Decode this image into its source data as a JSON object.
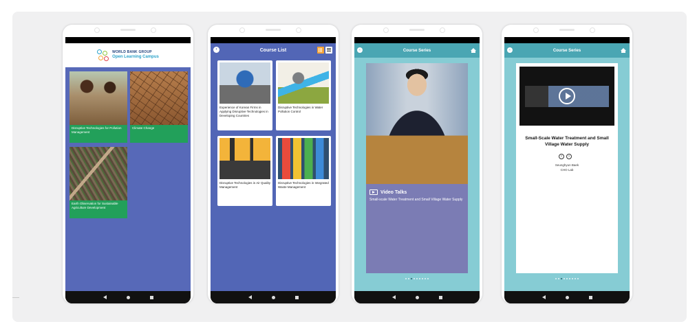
{
  "phones": {
    "home": {
      "logo": {
        "brand": "WORLD BANK GROUP",
        "name": "Open Learning Campus",
        "tagline": "",
        "colors": [
          "#2aa2c9",
          "#8dc63f",
          "#f5a335",
          "#e2404a"
        ]
      },
      "tiles": [
        {
          "label": "Disruptive Technologies for Pollution Management",
          "photo": "children-with-book"
        },
        {
          "label": "Climate Change",
          "photo": "cracked-dry-earth"
        },
        {
          "label": "Earth Observation for Sustainable Agriculture Development",
          "photo": "aerial-farmland"
        }
      ]
    },
    "course_list": {
      "title": "Course List",
      "courses": [
        {
          "label": "Experience of Korean Firms in Applying Disruptive Technologies in Developing Countries",
          "art": "earth-pollution"
        },
        {
          "label": "Disruptive Technologies in Water Pollution Control",
          "art": "pipe-discharge"
        },
        {
          "label": "Disruptive Technologies in Air Quality Management",
          "art": "factory-smoke"
        },
        {
          "label": "Disruptive Technologies in Integrated Waste Management",
          "art": "recycling-bins"
        }
      ]
    },
    "course_series": {
      "title": "Course Series",
      "category": "Video Talks",
      "description": "Small-scale Water Treatment and Small Village Water Supply",
      "pages": 9,
      "active_page": 3
    },
    "course_detail": {
      "title": "Course Series",
      "video_title": "Small-Scale Water Treatment and Small Village Water Supply",
      "author": "Seunghyun Baek",
      "organization": "CHO Lab",
      "pages": 9,
      "active_page": 3
    }
  },
  "colors": {
    "panel": "#f0f0f1",
    "home_blue": "#5769b8",
    "course_list_blue": "#5266b6",
    "series_teal": "#4aa6b3",
    "series_bg": "#86ccd4",
    "tile_green": "#22a05a",
    "grid_toggle_orange": "#f5a335"
  }
}
